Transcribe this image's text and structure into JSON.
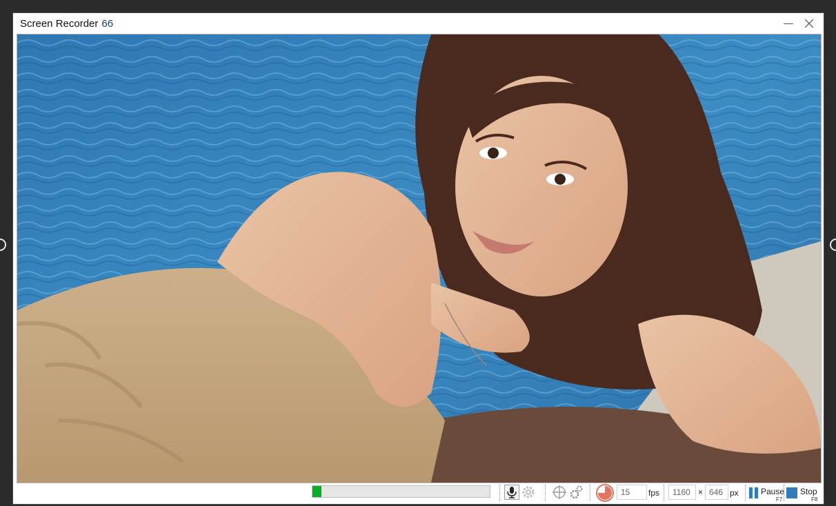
{
  "window": {
    "title": "Screen Recorder",
    "frame_count": "66",
    "controls": {
      "minimize": "minimize-icon",
      "close": "close-icon"
    }
  },
  "capture": {
    "description_icon": "recorded-screen-content"
  },
  "statusbar": {
    "progress": {
      "fraction": 0.05,
      "color": "#06b025"
    },
    "microphone_icon": "microphone-icon",
    "settings_icon": "gear-icon",
    "crosshair_icon": "crosshair-icon",
    "options_icon": "gears-icon",
    "timer_icon": "pie-timer-icon",
    "fps_value": "15",
    "fps_unit": "fps",
    "width_value": "1160",
    "times": "×",
    "height_value": "646",
    "size_unit": "px",
    "pause_label": "Pause",
    "pause_key": "F7",
    "stop_label": "Stop",
    "stop_key": "F8",
    "accent": "#2f7dbf",
    "timer_color": "#e57361"
  }
}
